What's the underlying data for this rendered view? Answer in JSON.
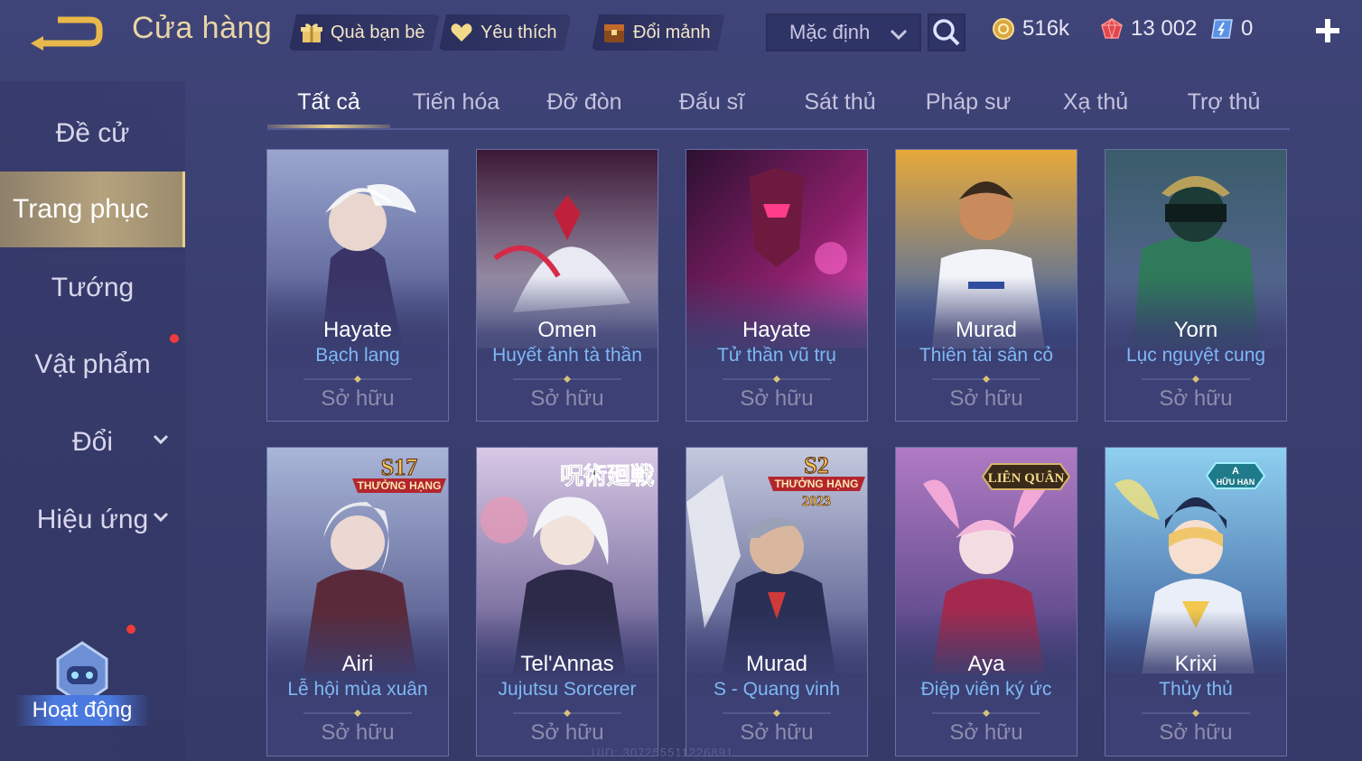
{
  "header": {
    "title": "Cửa hàng",
    "buttons": [
      {
        "label": "Quà bạn bè",
        "icon": "gift-icon"
      },
      {
        "label": "Yêu thích",
        "icon": "heart-icon"
      },
      {
        "label": "Đổi mảnh",
        "icon": "chest-icon"
      }
    ],
    "sort": {
      "value": "Mặc định"
    },
    "currencies": [
      {
        "icon": "gold-coin-icon",
        "value": "516k",
        "color": "#e9c46a"
      },
      {
        "icon": "ruby-gem-icon",
        "value": "13 002",
        "color": "#e0474c"
      },
      {
        "icon": "voucher-icon",
        "value": "0",
        "color": "#6aa8f0"
      }
    ]
  },
  "sidebar": {
    "items": [
      {
        "label": "Đề cử"
      },
      {
        "label": "Trang phục"
      },
      {
        "label": "Tướng"
      },
      {
        "label": "Vật phẩm"
      },
      {
        "label": "Đổi"
      },
      {
        "label": "Hiệu ứng"
      }
    ],
    "activity_label": "Hoạt động"
  },
  "tabs": [
    {
      "label": "Tất cả"
    },
    {
      "label": "Tiến hóa"
    },
    {
      "label": "Đỡ đòn"
    },
    {
      "label": "Đấu sĩ"
    },
    {
      "label": "Sát thủ"
    },
    {
      "label": "Pháp sư"
    },
    {
      "label": "Xạ thủ"
    },
    {
      "label": "Trợ thủ"
    }
  ],
  "cards": [
    {
      "hero": "Hayate",
      "skin": "Bạch lang",
      "status": "Sở hữu"
    },
    {
      "hero": "Omen",
      "skin": "Huyết ảnh tà thần",
      "status": "Sở hữu"
    },
    {
      "hero": "Hayate",
      "skin": "Tử thần vũ trụ",
      "status": "Sở hữu"
    },
    {
      "hero": "Murad",
      "skin": "Thiên tài sân cỏ",
      "status": "Sở hữu"
    },
    {
      "hero": "Yorn",
      "skin": "Lục nguyệt cung",
      "status": "Sở hữu"
    },
    {
      "hero": "Airi",
      "skin": "Lễ hội mùa xuân",
      "status": "Sở hữu",
      "badge_top": "S17",
      "badge_bottom": "THƯỞNG HẠNG"
    },
    {
      "hero": "Tel'Annas",
      "skin": "Jujutsu Sorcerer",
      "status": "Sở hữu",
      "badge_top": "呪術廻戦"
    },
    {
      "hero": "Murad",
      "skin": "S - Quang vinh",
      "status": "Sở hữu",
      "badge_top": "S2",
      "badge_bottom": "THƯỞNG HẠNG",
      "badge_year": "2023"
    },
    {
      "hero": "Aya",
      "skin": "Điệp viên ký ức",
      "status": "Sở hữu",
      "badge_top": "LIÊN QUÂN"
    },
    {
      "hero": "Krixi",
      "skin": "Thủy thủ",
      "status": "Sở hữu",
      "badge_top": "A",
      "badge_bottom": "HỮU HẠN"
    }
  ],
  "footer": {
    "uid": "UID: 307255511226891"
  }
}
